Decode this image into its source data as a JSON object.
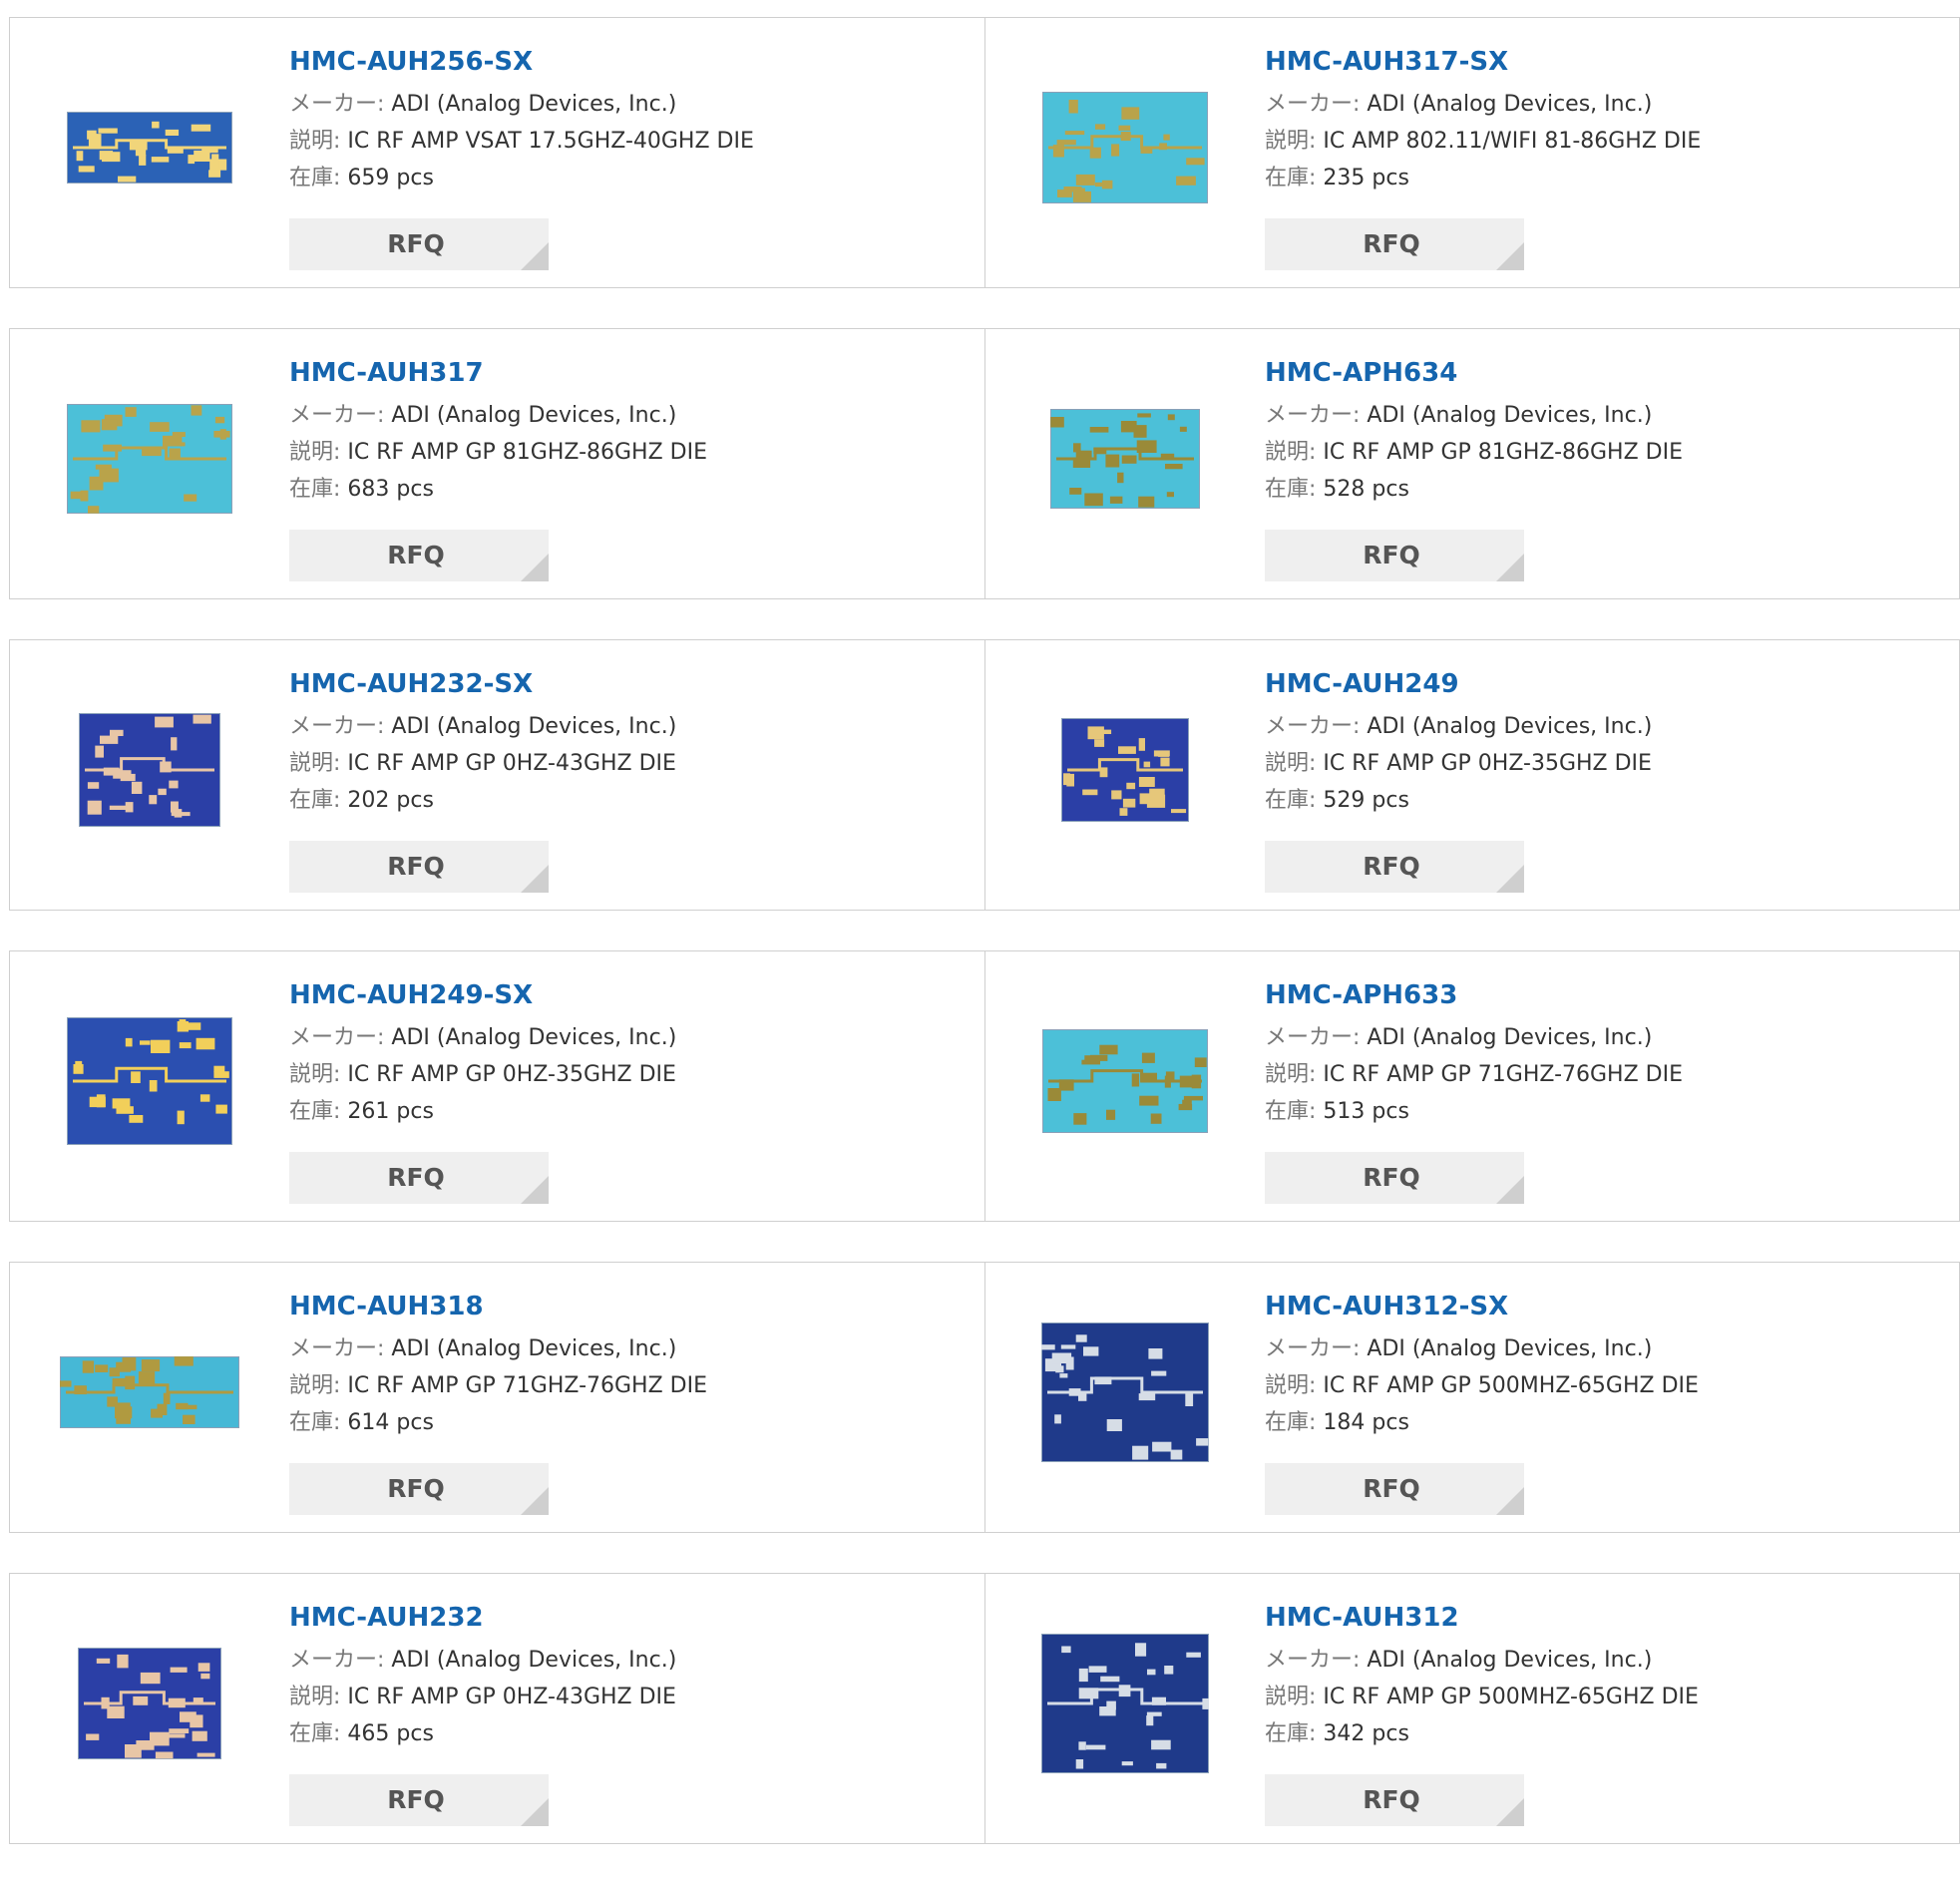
{
  "labels": {
    "maker": "メーカー:",
    "description": "説明:",
    "stock": "在庫:"
  },
  "rfq_label": "RFQ",
  "products": [
    {
      "name": "HMC-AUH256-SX",
      "maker": "ADI (Analog Devices, Inc.)",
      "description": "IC RF AMP VSAT 17.5GHZ-40GHZ DIE",
      "stock": "659 pcs",
      "chip_colors": {
        "bg": "#2b62b6",
        "fg": "#f1d57a"
      }
    },
    {
      "name": "HMC-AUH317-SX",
      "maker": "ADI (Analog Devices, Inc.)",
      "description": "IC AMP 802.11/WIFI 81-86GHZ DIE",
      "stock": "235 pcs",
      "chip_colors": {
        "bg": "#4cc0d8",
        "fg": "#b9a34a"
      }
    },
    {
      "name": "HMC-AUH317",
      "maker": "ADI (Analog Devices, Inc.)",
      "description": "IC RF AMP GP 81GHZ-86GHZ DIE",
      "stock": "683 pcs",
      "chip_colors": {
        "bg": "#4cc0d8",
        "fg": "#b9a34a"
      }
    },
    {
      "name": "HMC-APH634",
      "maker": "ADI (Analog Devices, Inc.)",
      "description": "IC RF AMP GP 81GHZ-86GHZ DIE",
      "stock": "528 pcs",
      "chip_colors": {
        "bg": "#4cc0d8",
        "fg": "#9a8a38"
      }
    },
    {
      "name": "HMC-AUH232-SX",
      "maker": "ADI (Analog Devices, Inc.)",
      "description": "IC RF AMP GP 0HZ-43GHZ DIE",
      "stock": "202 pcs",
      "chip_colors": {
        "bg": "#2b3fa6",
        "fg": "#e8c6a6"
      }
    },
    {
      "name": "HMC-AUH249",
      "maker": "ADI (Analog Devices, Inc.)",
      "description": "IC RF AMP GP 0HZ-35GHZ DIE",
      "stock": "529 pcs",
      "chip_colors": {
        "bg": "#2b3fa6",
        "fg": "#e6c77a"
      }
    },
    {
      "name": "HMC-AUH249-SX",
      "maker": "ADI (Analog Devices, Inc.)",
      "description": "IC RF AMP GP 0HZ-35GHZ DIE",
      "stock": "261 pcs",
      "chip_colors": {
        "bg": "#2b4fb0",
        "fg": "#f2cf5a"
      }
    },
    {
      "name": "HMC-APH633",
      "maker": "ADI (Analog Devices, Inc.)",
      "description": "IC RF AMP GP 71GHZ-76GHZ DIE",
      "stock": "513 pcs",
      "chip_colors": {
        "bg": "#4cc0d8",
        "fg": "#9a8a38"
      }
    },
    {
      "name": "HMC-AUH318",
      "maker": "ADI (Analog Devices, Inc.)",
      "description": "IC RF AMP GP 71GHZ-76GHZ DIE",
      "stock": "614 pcs",
      "chip_colors": {
        "bg": "#46b8d6",
        "fg": "#b09a40"
      }
    },
    {
      "name": "HMC-AUH312-SX",
      "maker": "ADI (Analog Devices, Inc.)",
      "description": "IC RF AMP GP 500MHZ-65GHZ DIE",
      "stock": "184 pcs",
      "chip_colors": {
        "bg": "#1f3a8a",
        "fg": "#d6dde6"
      }
    },
    {
      "name": "HMC-AUH232",
      "maker": "ADI (Analog Devices, Inc.)",
      "description": "IC RF AMP GP 0HZ-43GHZ DIE",
      "stock": "465 pcs",
      "chip_colors": {
        "bg": "#2b3fa6",
        "fg": "#e8c6a6"
      }
    },
    {
      "name": "HMC-AUH312",
      "maker": "ADI (Analog Devices, Inc.)",
      "description": "IC RF AMP GP 500MHZ-65GHZ DIE",
      "stock": "342 pcs",
      "chip_colors": {
        "bg": "#1f3a8a",
        "fg": "#d6dde6"
      }
    }
  ]
}
